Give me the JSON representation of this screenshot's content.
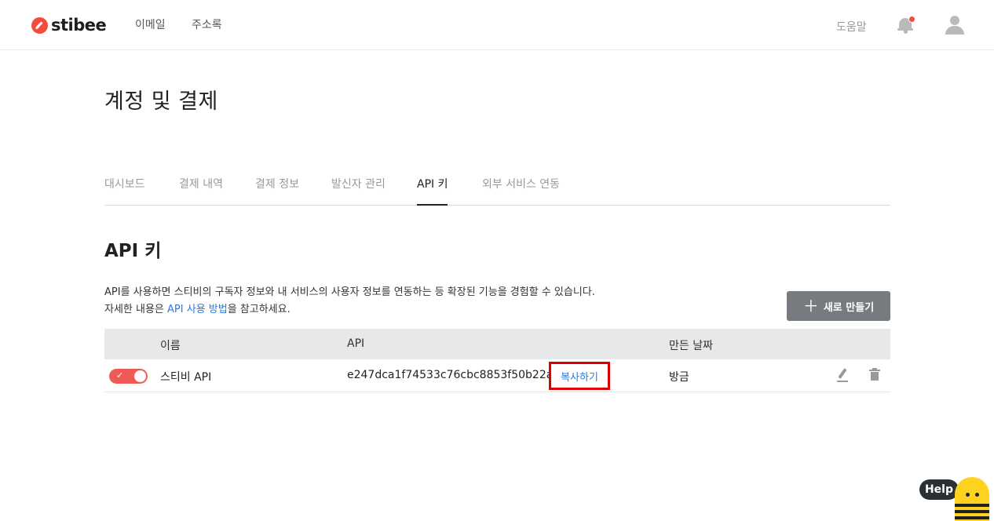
{
  "header": {
    "logo_text": "stibee",
    "nav": {
      "email": "이메일",
      "contacts": "주소록"
    },
    "help": "도움말"
  },
  "page": {
    "title": "계정 및 결제"
  },
  "tabs": [
    {
      "label": "대시보드",
      "active": false
    },
    {
      "label": "결제 내역",
      "active": false
    },
    {
      "label": "결제 정보",
      "active": false
    },
    {
      "label": "발신자 관리",
      "active": false
    },
    {
      "label": "API 키",
      "active": true
    },
    {
      "label": "외부 서비스 연동",
      "active": false
    }
  ],
  "section": {
    "title": "API 키",
    "desc_line1": "API를 사용하면 스티비의 구독자 정보와 내 서비스의 사용자 정보를 연동하는 등 확장된 기능을 경험할 수 있습니다.",
    "desc_line2_prefix": "자세한 내용은 ",
    "desc_link": "API 사용 방법",
    "desc_line2_suffix": "을 참고하세요.",
    "new_button": "새로 만들기"
  },
  "table": {
    "headers": {
      "name": "이름",
      "api": "API",
      "created": "만든 날짜"
    },
    "rows": [
      {
        "enabled": true,
        "name": "스티비 API",
        "api": "e247dca1f74533c76cbc8853f50b22a...",
        "copy": "복사하기",
        "created": "방금"
      }
    ]
  },
  "help_widget": {
    "label": "Help"
  },
  "colors": {
    "accent": "#f24c3d",
    "link": "#2a7ae2",
    "toggle_on": "#ef5a56",
    "highlight": "#e00000"
  }
}
